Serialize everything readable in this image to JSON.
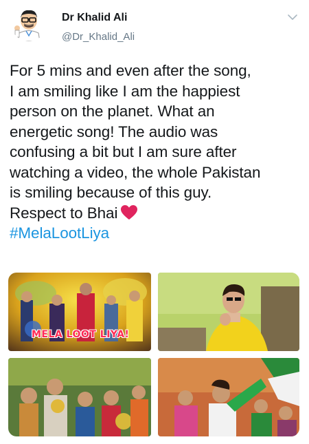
{
  "tweet": {
    "author_name": "Dr Khalid Ali",
    "author_handle": "@Dr_Khalid_Ali",
    "text_lines": [
      "For 5 mins and even after the song,",
      "I am smiling like I am the happiest",
      "person on the planet. What an",
      "energetic song! The audio was",
      "confusing a bit but I am sure after",
      "watching a video, the whole Pakistan",
      "is smiling because of this guy.",
      "Respect to Bhai"
    ],
    "hashtag": "#MelaLootLiya"
  },
  "media": {
    "count": 4,
    "first_image_title": "MELA LOOT LIYA!"
  },
  "icons": {
    "menu": "chevron-down-icon",
    "emoji": "red-heart-icon"
  },
  "colors": {
    "hashtag": "#1b95e0",
    "heart": "#e0245e",
    "handle": "#657786"
  }
}
